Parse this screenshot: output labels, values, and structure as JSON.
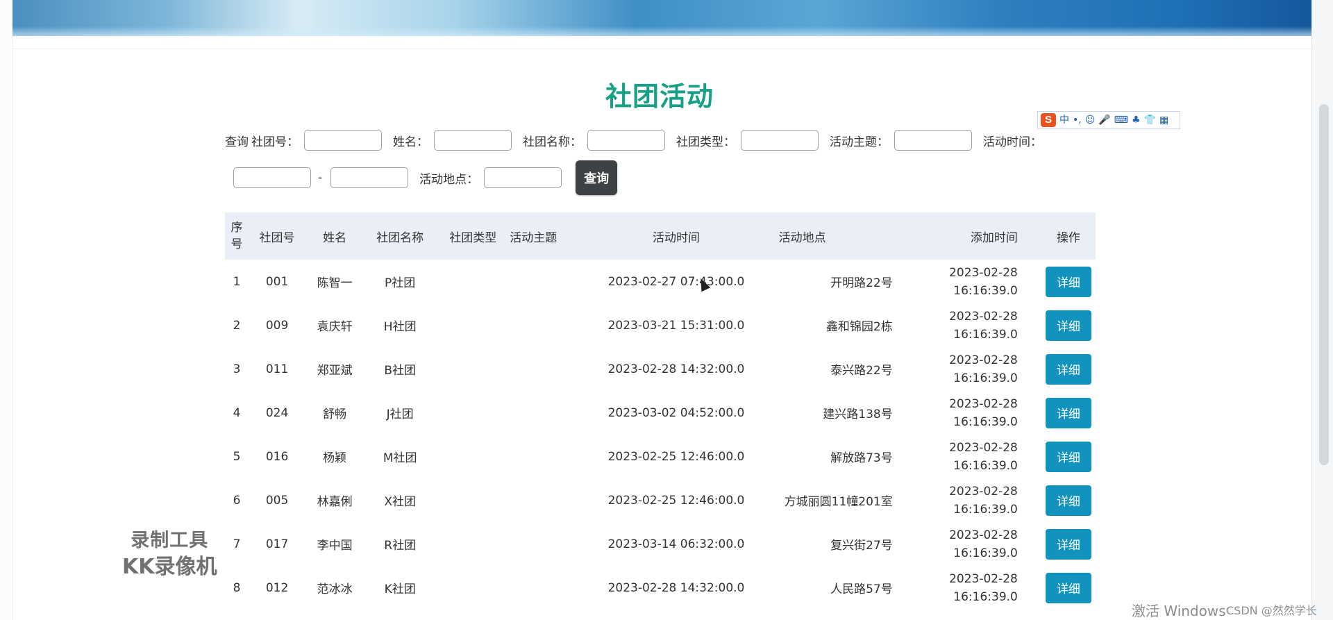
{
  "header": {
    "title": "社团活动"
  },
  "ime": {
    "logo": "S",
    "mode": "中",
    "items": [
      "•,",
      "☺",
      "🎤",
      "⌨",
      "♣",
      "👕",
      "▦"
    ]
  },
  "search": {
    "prefix": "查询",
    "fields": [
      {
        "label": "社团号：",
        "value": ""
      },
      {
        "label": "姓名：",
        "value": ""
      },
      {
        "label": "社团名称：",
        "value": ""
      },
      {
        "label": "社团类型：",
        "value": ""
      },
      {
        "label": "活动主题：",
        "value": ""
      },
      {
        "label": "活动时间：",
        "value": ""
      }
    ],
    "time_start": "",
    "range_sep": "-",
    "time_end": "",
    "place_label": "活动地点：",
    "place_value": "",
    "button": "查询"
  },
  "table": {
    "headers": [
      "序号",
      "社团号",
      "姓名",
      "社团名称",
      "社团类型",
      "活动主题",
      "活动时间",
      "活动地点",
      "添加时间",
      "操作"
    ],
    "rows": [
      {
        "idx": "1",
        "club_no": "001",
        "name": "陈智一",
        "club_name": "P社团",
        "club_type": "",
        "topic": "",
        "time": "2023-02-27 07:43:00.0",
        "place": "开明路22号",
        "added_date": "2023-02-28",
        "added_time": "16:16:39.0",
        "action": "详细"
      },
      {
        "idx": "2",
        "club_no": "009",
        "name": "袁庆轩",
        "club_name": "H社团",
        "club_type": "",
        "topic": "",
        "time": "2023-03-21 15:31:00.0",
        "place": "鑫和锦园2栋",
        "added_date": "2023-02-28",
        "added_time": "16:16:39.0",
        "action": "详细"
      },
      {
        "idx": "3",
        "club_no": "011",
        "name": "郑亚斌",
        "club_name": "B社团",
        "club_type": "",
        "topic": "",
        "time": "2023-02-28 14:32:00.0",
        "place": "泰兴路22号",
        "added_date": "2023-02-28",
        "added_time": "16:16:39.0",
        "action": "详细"
      },
      {
        "idx": "4",
        "club_no": "024",
        "name": "舒畅",
        "club_name": "J社团",
        "club_type": "",
        "topic": "",
        "time": "2023-03-02 04:52:00.0",
        "place": "建兴路138号",
        "added_date": "2023-02-28",
        "added_time": "16:16:39.0",
        "action": "详细"
      },
      {
        "idx": "5",
        "club_no": "016",
        "name": "杨颖",
        "club_name": "M社团",
        "club_type": "",
        "topic": "",
        "time": "2023-02-25 12:46:00.0",
        "place": "解放路73号",
        "added_date": "2023-02-28",
        "added_time": "16:16:39.0",
        "action": "详细"
      },
      {
        "idx": "6",
        "club_no": "005",
        "name": "林嘉俐",
        "club_name": "X社团",
        "club_type": "",
        "topic": "",
        "time": "2023-02-25 12:46:00.0",
        "place": "方城丽圆11幢201室",
        "added_date": "2023-02-28",
        "added_time": "16:16:39.0",
        "action": "详细"
      },
      {
        "idx": "7",
        "club_no": "017",
        "name": "李中国",
        "club_name": "R社团",
        "club_type": "",
        "topic": "",
        "time": "2023-03-14 06:32:00.0",
        "place": "复兴街27号",
        "added_date": "2023-02-28",
        "added_time": "16:16:39.0",
        "action": "详细"
      },
      {
        "idx": "8",
        "club_no": "012",
        "name": "范冰冰",
        "club_name": "K社团",
        "club_type": "",
        "topic": "",
        "time": "2023-02-28 14:32:00.0",
        "place": "人民路57号",
        "added_date": "2023-02-28",
        "added_time": "16:16:39.0",
        "action": "详细"
      }
    ]
  },
  "overlay": {
    "recorder_line1": "录制工具",
    "recorder_line2": "KK录像机",
    "activate": "激活 Windows",
    "csdn": "CSDN @然然学长"
  },
  "colors": {
    "title": "#17a086",
    "detail_button": "#1293bd",
    "query_button": "#3f4244",
    "header_row": "#eaeef6"
  }
}
